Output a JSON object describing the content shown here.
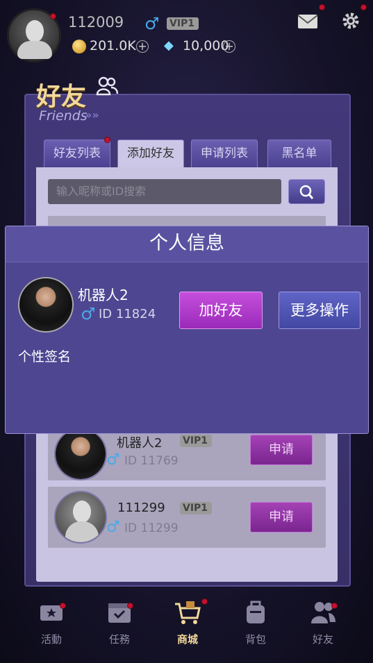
{
  "header": {
    "username": "112009",
    "gender_symbol": "♂",
    "vip": "VIP1",
    "coins": "201.0K",
    "gems": "10,000"
  },
  "friends_panel": {
    "title": "好友",
    "subtitle": "Friends",
    "tabs": [
      {
        "label": "好友列表",
        "active": false
      },
      {
        "label": "添加好友",
        "active": true
      },
      {
        "label": "申请列表",
        "active": false
      },
      {
        "label": "黑名单",
        "active": false
      }
    ],
    "search_placeholder": "输入昵称或ID搜索",
    "rows": [
      {
        "name": "机器人2",
        "vip": "VIP1",
        "id": "ID 11769",
        "action": "申请"
      },
      {
        "name": "111299",
        "vip": "VIP1",
        "id": "ID 11299",
        "action": "申请"
      }
    ]
  },
  "modal": {
    "title": "个人信息",
    "name": "机器人2",
    "gender_symbol": "♂",
    "id": "ID 11824",
    "add_friend": "加好友",
    "more_actions": "更多操作",
    "signature": "个性签名"
  },
  "nav": [
    {
      "label": "活動",
      "icon": "event-ticket-icon",
      "active": false
    },
    {
      "label": "任務",
      "icon": "task-calendar-icon",
      "active": false
    },
    {
      "label": "商城",
      "icon": "shop-cart-icon",
      "active": true
    },
    {
      "label": "背包",
      "icon": "backpack-icon",
      "active": false
    },
    {
      "label": "好友",
      "icon": "friends-icon",
      "active": false
    }
  ],
  "colors": {
    "panel": "#43397a",
    "accent_purple": "#9a2ab8",
    "gold_title": "#f2d89a"
  }
}
